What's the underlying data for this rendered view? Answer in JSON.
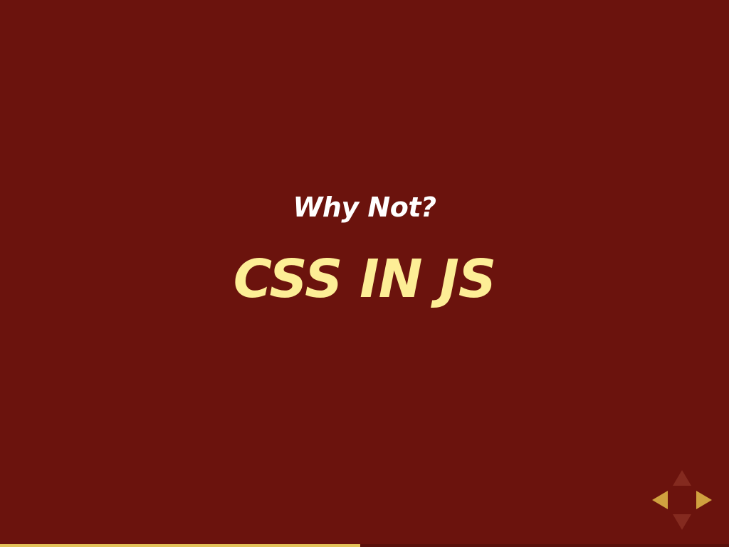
{
  "slide": {
    "subtitle": "Why Not?",
    "title": "CSS IN JS"
  },
  "colors": {
    "background": "#6b130d",
    "subtitle": "#ffffff",
    "title": "#fdee96",
    "control_active": "#d0a13f",
    "control_disabled": "#842a1f",
    "progress": "#e3c25a"
  },
  "controls": {
    "up_icon": "arrow-up-icon",
    "down_icon": "arrow-down-icon",
    "left_icon": "arrow-left-icon",
    "right_icon": "arrow-right-icon",
    "up_enabled": false,
    "down_enabled": false,
    "left_enabled": true,
    "right_enabled": true
  },
  "progress": {
    "fraction": 0.494
  }
}
